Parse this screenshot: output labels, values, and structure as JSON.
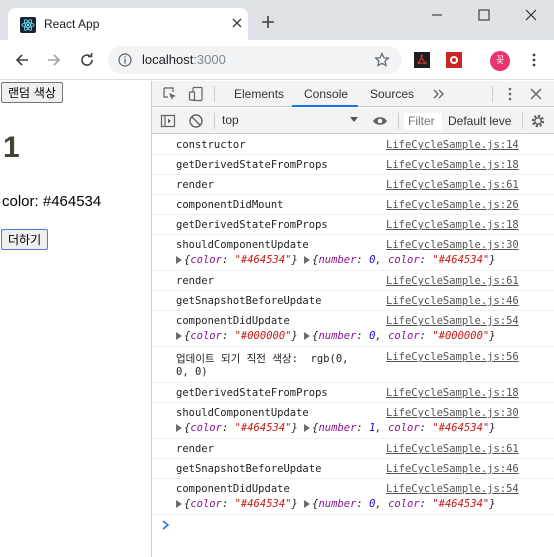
{
  "browser": {
    "tab_title": "React App",
    "url_host": "localhost",
    "url_port": ":3000",
    "avatar_letter": "꽃"
  },
  "page": {
    "random_button": "랜덤 색상",
    "number": "1",
    "color_label": "color: #464534",
    "add_button": "더하기",
    "number_color": "#464534"
  },
  "devtools": {
    "tabs": [
      "Elements",
      "Console",
      "Sources"
    ],
    "active_tab": "Console",
    "context": "top",
    "filter_placeholder": "Filter",
    "levels": "Default leve",
    "accent": "#1a73e8"
  },
  "console": {
    "messages": [
      {
        "text": "constructor",
        "src": "LifeCycleSample.js:14"
      },
      {
        "text": "getDerivedStateFromProps",
        "src": "LifeCycleSample.js:18"
      },
      {
        "text": "render",
        "src": "LifeCycleSample.js:61"
      },
      {
        "text": "componentDidMount",
        "src": "LifeCycleSample.js:26"
      },
      {
        "text": "getDerivedStateFromProps",
        "src": "LifeCycleSample.js:18"
      },
      {
        "text": "shouldComponentUpdate",
        "src": "LifeCycleSample.js:30",
        "obj1_color": "\"#464534\"",
        "obj2_number": "0",
        "obj2_color": "\"#464534\""
      },
      {
        "text": "render",
        "src": "LifeCycleSample.js:61"
      },
      {
        "text": "getSnapshotBeforeUpdate",
        "src": "LifeCycleSample.js:46"
      },
      {
        "text": "componentDidUpdate",
        "src": "LifeCycleSample.js:54",
        "obj1_color": "\"#000000\"",
        "obj2_number": "0",
        "obj2_color": "\"#000000\""
      },
      {
        "text": "업데이트 되기 직전 색상:  rgb(0,",
        "text2": "0, 0)",
        "src": "LifeCycleSample.js:56"
      },
      {
        "text": "getDerivedStateFromProps",
        "src": "LifeCycleSample.js:18"
      },
      {
        "text": "shouldComponentUpdate",
        "src": "LifeCycleSample.js:30",
        "obj1_color": "\"#464534\"",
        "obj2_number": "1",
        "obj2_color": "\"#464534\""
      },
      {
        "text": "render",
        "src": "LifeCycleSample.js:61"
      },
      {
        "text": "getSnapshotBeforeUpdate",
        "src": "LifeCycleSample.js:46"
      },
      {
        "text": "componentDidUpdate",
        "src": "LifeCycleSample.js:54",
        "obj1_color": "\"#464534\"",
        "obj2_number": "0",
        "obj2_color": "\"#464534\""
      }
    ]
  }
}
